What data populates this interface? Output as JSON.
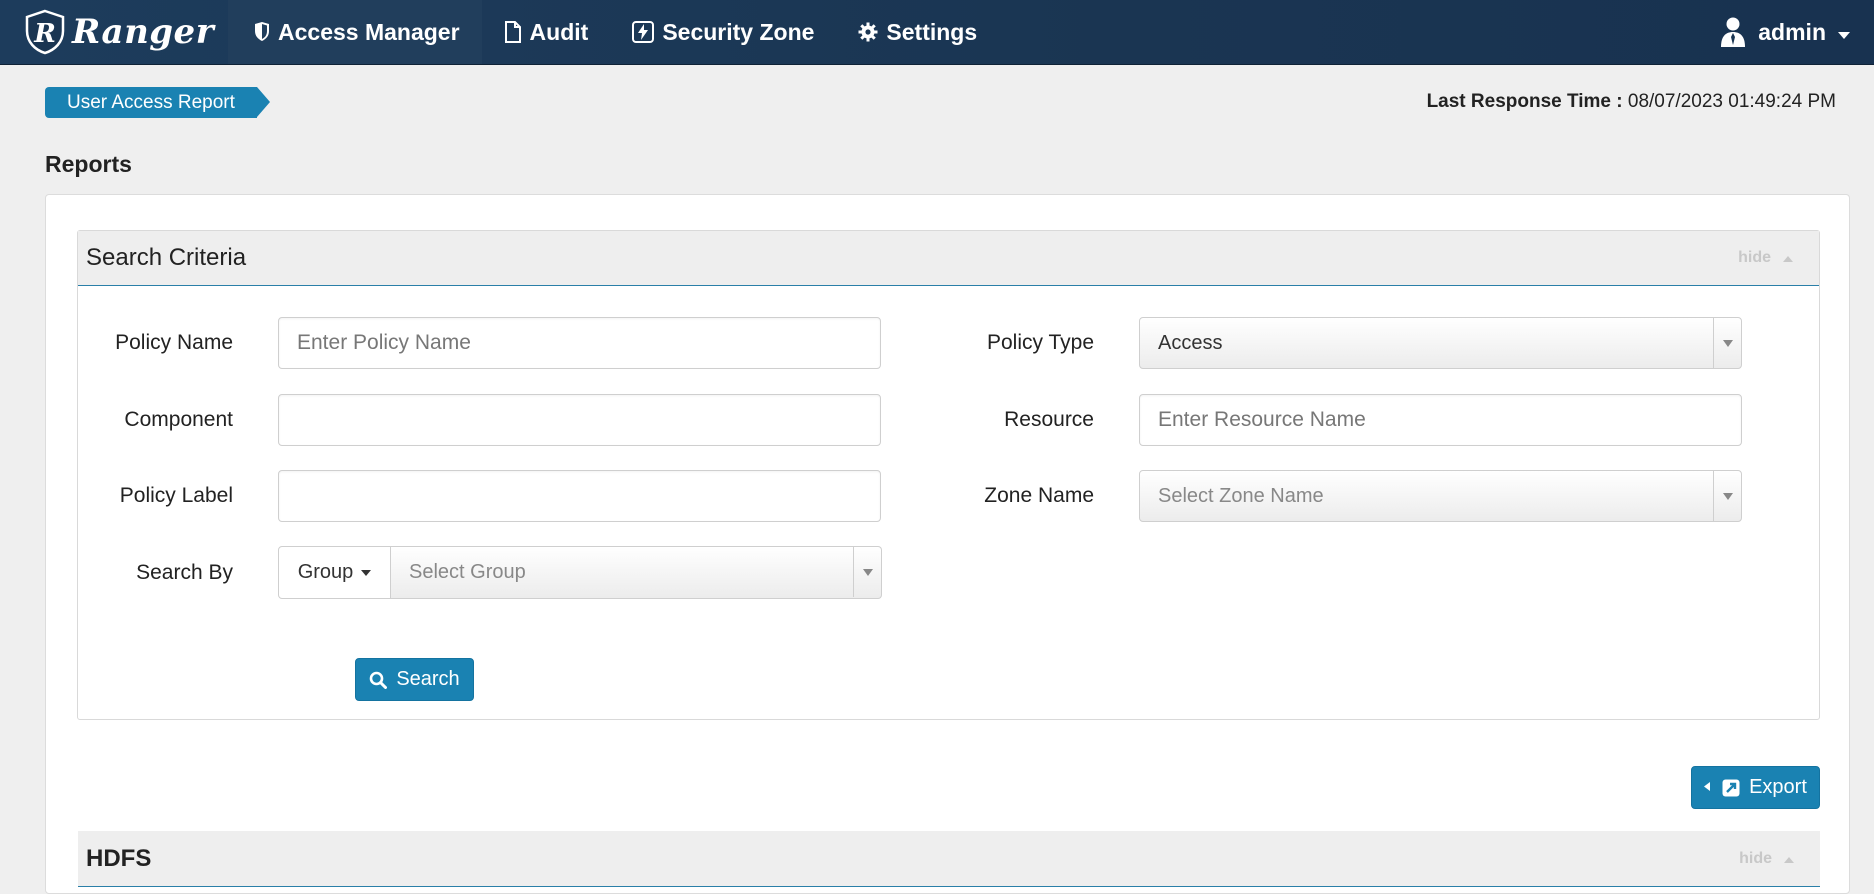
{
  "navbar": {
    "brand": "Ranger",
    "items": [
      {
        "label": "Access Manager",
        "icon": "shield-icon",
        "active": true
      },
      {
        "label": "Audit",
        "icon": "file-icon",
        "active": false
      },
      {
        "label": "Security Zone",
        "icon": "bolt-icon",
        "active": false
      },
      {
        "label": "Settings",
        "icon": "gear-icon",
        "active": false
      }
    ],
    "user": "admin"
  },
  "breadcrumb": {
    "label": "User Access Report"
  },
  "last_response": {
    "label": "Last Response Time :",
    "value": "08/07/2023 01:49:24 PM"
  },
  "page_title": "Reports",
  "search_criteria": {
    "title": "Search Criteria",
    "hide_label": "hide",
    "policy_name": {
      "label": "Policy Name",
      "placeholder": "Enter Policy Name",
      "value": ""
    },
    "component": {
      "label": "Component",
      "value": ""
    },
    "policy_label": {
      "label": "Policy Label",
      "value": ""
    },
    "search_by": {
      "label": "Search By",
      "mode": "Group",
      "placeholder": "Select Group"
    },
    "policy_type": {
      "label": "Policy Type",
      "value": "Access"
    },
    "resource": {
      "label": "Resource",
      "placeholder": "Enter Resource Name",
      "value": ""
    },
    "zone_name": {
      "label": "Zone Name",
      "placeholder": "Select Zone Name"
    },
    "search_button": "Search"
  },
  "export_button": "Export",
  "hdfs_section": {
    "title": "HDFS",
    "hide_label": "hide"
  },
  "colors": {
    "navbar": "#1d3c5c",
    "primary": "#1a82b2",
    "background": "#efefef"
  }
}
